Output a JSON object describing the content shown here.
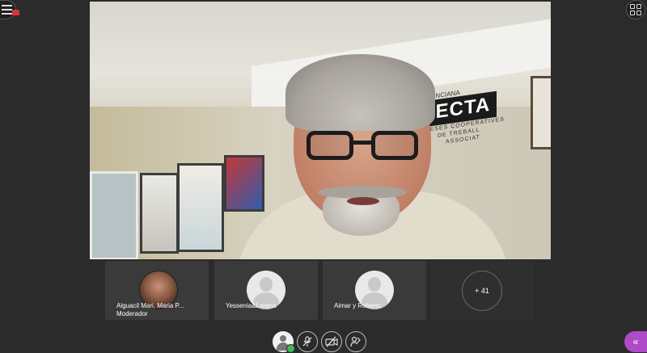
{
  "toolbar": {
    "menu_icon": "hamburger-icon",
    "recording_icon": "recording-indicator-icon",
    "layout_icon": "grid-layout-icon"
  },
  "main_video": {
    "background_sign": {
      "line1": "ANO VALENCIANA",
      "brand": "FEVECTA",
      "line2": "D'EMPRESES COOPERATIVES",
      "line3": "DE TREBALL",
      "line4": "ASSOCIAT"
    }
  },
  "participants": [
    {
      "name": "Alguacil Mari, Maria P...",
      "role": "Moderador",
      "avatar": "photo"
    },
    {
      "name": "Yessenia&Lorena",
      "role": "",
      "avatar": "user-placeholder-icon"
    },
    {
      "name": "Aimar y Roberto",
      "role": "",
      "avatar": "user-placeholder-icon"
    }
  ],
  "more_participants": {
    "label": "+ 41"
  },
  "controls": {
    "user": "user-icon",
    "mic": "microphone-muted-icon",
    "camera": "camera-off-icon",
    "share": "share-screen-icon",
    "chat": "chevron-left-double-icon",
    "chat_glyph": "«"
  },
  "colors": {
    "background": "#2b2b2b",
    "tile": "#3a3a3a",
    "accent": "#b04bc7",
    "status_ok": "#3fb950",
    "recording": "#dd3333"
  }
}
